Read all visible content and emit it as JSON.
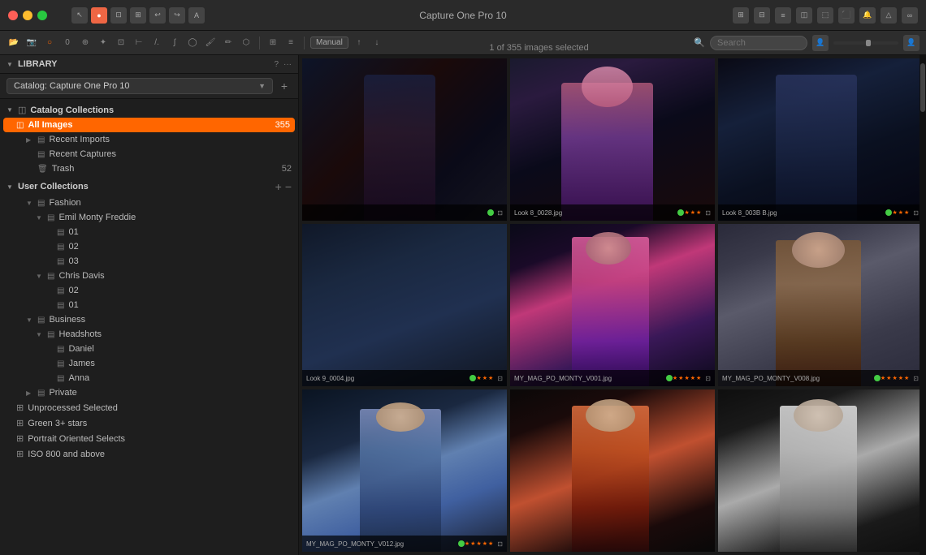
{
  "app": {
    "title": "Capture One Pro 10",
    "window": {
      "traffic_lights": [
        "red",
        "yellow",
        "green"
      ]
    }
  },
  "toolbar": {
    "image_counter": "1 of 355 images selected",
    "search_placeholder": "Search",
    "mode": "Manual"
  },
  "sidebar": {
    "title": "LIBRARY",
    "catalog_name": "Catalog: Capture One Pro 10",
    "sections": {
      "catalog_collections": {
        "label": "Catalog Collections",
        "items": [
          {
            "id": "all-images",
            "label": "All Images",
            "count": "355",
            "active": true,
            "indent": 1
          },
          {
            "id": "recent-imports",
            "label": "Recent Imports",
            "count": "",
            "indent": 2,
            "expandable": true
          },
          {
            "id": "recent-captures",
            "label": "Recent Captures",
            "count": "",
            "indent": 2
          },
          {
            "id": "trash",
            "label": "Trash",
            "count": "52",
            "indent": 2
          }
        ]
      },
      "user_collections": {
        "label": "User Collections",
        "items": [
          {
            "id": "fashion",
            "label": "Fashion",
            "indent": 2,
            "expandable": true,
            "expanded": true
          },
          {
            "id": "emil-monty-freddie",
            "label": "Emil Monty Freddie",
            "indent": 3,
            "expandable": true,
            "expanded": true
          },
          {
            "id": "folder-01a",
            "label": "01",
            "indent": 4
          },
          {
            "id": "folder-02a",
            "label": "02",
            "indent": 4
          },
          {
            "id": "folder-03",
            "label": "03",
            "indent": 4
          },
          {
            "id": "chris-davis",
            "label": "Chris Davis",
            "indent": 3,
            "expandable": true,
            "expanded": true
          },
          {
            "id": "folder-02b",
            "label": "02",
            "indent": 4
          },
          {
            "id": "folder-01b",
            "label": "01",
            "indent": 4
          },
          {
            "id": "business",
            "label": "Business",
            "indent": 2,
            "expandable": true,
            "expanded": true
          },
          {
            "id": "headshots",
            "label": "Headshots",
            "indent": 3,
            "expandable": true,
            "expanded": true
          },
          {
            "id": "daniel",
            "label": "Daniel",
            "indent": 4
          },
          {
            "id": "james",
            "label": "James",
            "indent": 4
          },
          {
            "id": "anna",
            "label": "Anna",
            "indent": 4
          },
          {
            "id": "private",
            "label": "Private",
            "indent": 2,
            "expandable": true,
            "expanded": false
          },
          {
            "id": "unprocessed-selected",
            "label": "Unprocessed Selected",
            "indent": 1,
            "smart": true
          },
          {
            "id": "green-3-stars",
            "label": "Green 3+ stars",
            "indent": 1,
            "smart": true
          },
          {
            "id": "portrait-oriented-selects",
            "label": "Portrait Oriented Selects",
            "indent": 1,
            "smart": true
          },
          {
            "id": "iso-800-above",
            "label": "ISO 800 and above",
            "indent": 1,
            "smart": true
          }
        ]
      }
    }
  },
  "image_grid": {
    "images": [
      {
        "id": 1,
        "filename": "",
        "stars": "",
        "style": "dark-blue",
        "selected": false
      },
      {
        "id": 2,
        "filename": "Look 8_0028.jpg",
        "stars": "★★★",
        "style": "fashion-1",
        "selected": false
      },
      {
        "id": 3,
        "filename": "Look 8_003B B.jpg",
        "stars": "★★★",
        "style": "fashion-dark",
        "selected": false
      },
      {
        "id": 4,
        "filename": "Look 9_0004.jpg",
        "stars": "★★★",
        "style": "blue-dark",
        "selected": false
      },
      {
        "id": 5,
        "filename": "MY_MAG_PO_MONTY_V001.jpg",
        "stars": "★★★★★",
        "style": "fashion-pink",
        "selected": false
      },
      {
        "id": 6,
        "filename": "MY_MAG_PO_MONTY_V008.jpg",
        "stars": "★★★★★",
        "style": "portrait-selected",
        "selected": true
      },
      {
        "id": 7,
        "filename": "MY_MAG_PO_MONTY_V012.jpg",
        "stars": "★★★★★",
        "style": "jacket-blue",
        "selected": false
      },
      {
        "id": 8,
        "filename": "",
        "stars": "",
        "style": "colorful1",
        "selected": false
      },
      {
        "id": 9,
        "filename": "",
        "stars": "",
        "style": "grey-white",
        "selected": false
      },
      {
        "id": 10,
        "filename": "",
        "stars": "",
        "style": "bw-dramatic",
        "selected": false
      }
    ]
  }
}
